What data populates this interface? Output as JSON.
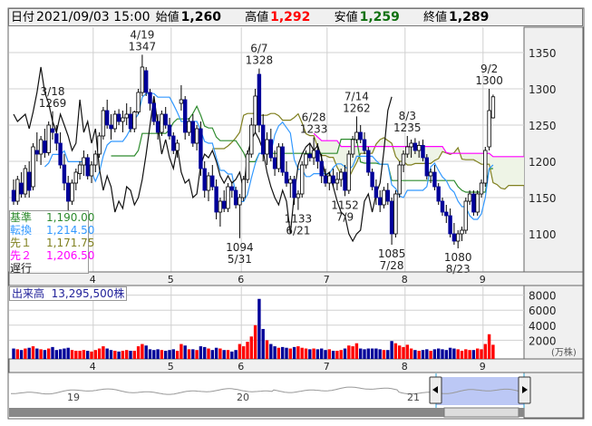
{
  "header": {
    "date_label": "日付",
    "date": "2021/09/03 15:00",
    "open_label": "始値",
    "open": "1,260",
    "high_label": "高値",
    "high": "1,292",
    "low_label": "安値",
    "low": "1,259",
    "close_label": "終値",
    "close": "1,289"
  },
  "legend": {
    "kijun": {
      "label": "基準",
      "value": "1,190.00",
      "color": "#2e8b2e"
    },
    "tenkan": {
      "label": "転換",
      "value": "1,214.50",
      "color": "#3399ff"
    },
    "senkou1": {
      "label": "先１",
      "value": "1,171.75",
      "color": "#808020"
    },
    "senkou2": {
      "label": "先２",
      "value": "1,206.50",
      "color": "#ff00ff"
    },
    "chikou": {
      "label": "遅行"
    }
  },
  "volume_label": {
    "label": "出来高",
    "value": "13,295,500株"
  },
  "colors": {
    "up_body": "#ffffff",
    "down_body": "#000099",
    "vol_up": "#ff0000",
    "vol_down": "#000099",
    "vol_flat": "#888888",
    "cloud": "#eef4e6",
    "nav_sel": "#bcc8f5"
  },
  "chart_data": {
    "type": "candlestick",
    "title": "",
    "price_axis": {
      "ticks": [
        1100,
        1150,
        1200,
        1250,
        1300,
        1350
      ],
      "range": [
        1047,
        1385
      ]
    },
    "volume_axis": {
      "ticks": [
        2000,
        4000,
        6000,
        8000
      ],
      "unit": "(万株)",
      "range": [
        0,
        9000
      ]
    },
    "month_labels": [
      {
        "label": "4",
        "start": 21
      },
      {
        "label": "5",
        "start": 41
      },
      {
        "label": "6",
        "start": 59
      },
      {
        "label": "7",
        "start": 81
      },
      {
        "label": "8",
        "start": 101
      },
      {
        "label": "9",
        "start": 121
      }
    ],
    "candles_ohlcv": [
      [
        1160,
        1175,
        1140,
        1145,
        900
      ],
      [
        1145,
        1180,
        1140,
        1175,
        800
      ],
      [
        1170,
        1185,
        1150,
        1155,
        700
      ],
      [
        1155,
        1195,
        1150,
        1190,
        900
      ],
      [
        1185,
        1200,
        1150,
        1160,
        1000
      ],
      [
        1165,
        1225,
        1160,
        1220,
        1200
      ],
      [
        1215,
        1240,
        1200,
        1210,
        900
      ],
      [
        1210,
        1235,
        1195,
        1230,
        800
      ],
      [
        1228,
        1245,
        1205,
        1212,
        700
      ],
      [
        1212,
        1255,
        1208,
        1250,
        900
      ],
      [
        1245,
        1269,
        1230,
        1240,
        1100
      ],
      [
        1238,
        1250,
        1215,
        1225,
        700
      ],
      [
        1225,
        1240,
        1190,
        1195,
        800
      ],
      [
        1195,
        1210,
        1160,
        1170,
        900
      ],
      [
        1170,
        1180,
        1130,
        1145,
        1000
      ],
      [
        1145,
        1175,
        1140,
        1170,
        700
      ],
      [
        1170,
        1190,
        1160,
        1185,
        600
      ],
      [
        1183,
        1200,
        1175,
        1195,
        600
      ],
      [
        1195,
        1215,
        1180,
        1205,
        700
      ],
      [
        1205,
        1210,
        1175,
        1180,
        600
      ],
      [
        1180,
        1200,
        1170,
        1195,
        500
      ],
      [
        1195,
        1215,
        1185,
        1210,
        700
      ],
      [
        1210,
        1240,
        1205,
        1235,
        900
      ],
      [
        1235,
        1275,
        1230,
        1270,
        1200
      ],
      [
        1270,
        1285,
        1245,
        1250,
        900
      ],
      [
        1250,
        1265,
        1230,
        1245,
        700
      ],
      [
        1245,
        1270,
        1240,
        1265,
        600
      ],
      [
        1265,
        1272,
        1250,
        1255,
        500
      ],
      [
        1255,
        1270,
        1240,
        1260,
        600
      ],
      [
        1260,
        1280,
        1250,
        1265,
        700
      ],
      [
        1265,
        1275,
        1240,
        1245,
        600
      ],
      [
        1245,
        1270,
        1240,
        1268,
        600
      ],
      [
        1268,
        1300,
        1265,
        1295,
        1200
      ],
      [
        1295,
        1347,
        1290,
        1330,
        1500
      ],
      [
        1325,
        1330,
        1290,
        1295,
        1300
      ],
      [
        1295,
        1300,
        1270,
        1280,
        800
      ],
      [
        1280,
        1285,
        1250,
        1255,
        700
      ],
      [
        1255,
        1265,
        1230,
        1240,
        800
      ],
      [
        1240,
        1270,
        1235,
        1265,
        700
      ],
      [
        1265,
        1275,
        1245,
        1250,
        600
      ],
      [
        1250,
        1260,
        1230,
        1235,
        700
      ],
      [
        1235,
        1240,
        1210,
        1215,
        800
      ],
      [
        1215,
        1230,
        1205,
        1225,
        600
      ],
      [
        1280,
        1305,
        1270,
        1285,
        1500
      ],
      [
        1285,
        1290,
        1230,
        1240,
        1300
      ],
      [
        1240,
        1260,
        1235,
        1255,
        800
      ],
      [
        1255,
        1265,
        1220,
        1225,
        800
      ],
      [
        1225,
        1250,
        1215,
        1245,
        700
      ],
      [
        1245,
        1255,
        1180,
        1190,
        1200
      ],
      [
        1190,
        1200,
        1150,
        1160,
        1100
      ],
      [
        1160,
        1185,
        1145,
        1180,
        900
      ],
      [
        1180,
        1195,
        1160,
        1165,
        700
      ],
      [
        1165,
        1175,
        1120,
        1130,
        1000
      ],
      [
        1130,
        1150,
        1110,
        1145,
        900
      ],
      [
        1145,
        1160,
        1130,
        1135,
        700
      ],
      [
        1135,
        1170,
        1130,
        1165,
        700
      ],
      [
        1165,
        1172,
        1150,
        1160,
        500
      ],
      [
        1160,
        1165,
        1135,
        1140,
        700
      ],
      [
        1140,
        1155,
        1094,
        1150,
        1500
      ],
      [
        1150,
        1180,
        1145,
        1175,
        1200
      ],
      [
        1175,
        1215,
        1170,
        1210,
        1800
      ],
      [
        1210,
        1260,
        1205,
        1250,
        2500
      ],
      [
        1250,
        1300,
        1240,
        1290,
        4000
      ],
      [
        1320,
        1328,
        1240,
        1250,
        7500
      ],
      [
        1250,
        1265,
        1200,
        1210,
        3500
      ],
      [
        1210,
        1240,
        1195,
        1230,
        2000
      ],
      [
        1230,
        1245,
        1200,
        1205,
        1500
      ],
      [
        1205,
        1215,
        1180,
        1190,
        1200
      ],
      [
        1190,
        1225,
        1185,
        1220,
        1000
      ],
      [
        1220,
        1225,
        1180,
        1185,
        1100
      ],
      [
        1185,
        1200,
        1165,
        1170,
        1000
      ],
      [
        1170,
        1180,
        1150,
        1175,
        900
      ],
      [
        1175,
        1180,
        1140,
        1150,
        1100
      ],
      [
        1150,
        1160,
        1133,
        1155,
        1200
      ],
      [
        1155,
        1200,
        1150,
        1195,
        1000
      ],
      [
        1195,
        1215,
        1190,
        1210,
        900
      ],
      [
        1210,
        1225,
        1200,
        1205,
        800
      ],
      [
        1205,
        1233,
        1195,
        1215,
        900
      ],
      [
        1215,
        1225,
        1190,
        1200,
        800
      ],
      [
        1200,
        1210,
        1170,
        1180,
        900
      ],
      [
        1180,
        1190,
        1165,
        1170,
        700
      ],
      [
        1170,
        1185,
        1160,
        1180,
        800
      ],
      [
        1180,
        1190,
        1165,
        1170,
        600
      ],
      [
        1170,
        1185,
        1160,
        1175,
        600
      ],
      [
        1175,
        1190,
        1165,
        1185,
        700
      ],
      [
        1185,
        1195,
        1152,
        1160,
        900
      ],
      [
        1160,
        1215,
        1155,
        1210,
        1300
      ],
      [
        1210,
        1235,
        1205,
        1230,
        1200
      ],
      [
        1230,
        1262,
        1225,
        1240,
        1600
      ],
      [
        1240,
        1250,
        1225,
        1230,
        900
      ],
      [
        1230,
        1240,
        1210,
        1215,
        800
      ],
      [
        1215,
        1220,
        1180,
        1185,
        900
      ],
      [
        1185,
        1190,
        1160,
        1165,
        900
      ],
      [
        1165,
        1175,
        1140,
        1150,
        900
      ],
      [
        1150,
        1160,
        1130,
        1140,
        800
      ],
      [
        1140,
        1165,
        1135,
        1160,
        700
      ],
      [
        1160,
        1170,
        1140,
        1145,
        700
      ],
      [
        1145,
        1150,
        1085,
        1100,
        1900
      ],
      [
        1100,
        1160,
        1095,
        1155,
        1600
      ],
      [
        1155,
        1200,
        1150,
        1195,
        1300
      ],
      [
        1195,
        1215,
        1185,
        1210,
        1100
      ],
      [
        1210,
        1235,
        1205,
        1220,
        1400
      ],
      [
        1220,
        1230,
        1205,
        1225,
        900
      ],
      [
        1225,
        1232,
        1210,
        1215,
        700
      ],
      [
        1215,
        1228,
        1205,
        1222,
        600
      ],
      [
        1222,
        1230,
        1200,
        1205,
        700
      ],
      [
        1205,
        1210,
        1175,
        1180,
        800
      ],
      [
        1180,
        1190,
        1170,
        1185,
        600
      ],
      [
        1185,
        1195,
        1160,
        1165,
        800
      ],
      [
        1165,
        1170,
        1140,
        1145,
        900
      ],
      [
        1145,
        1150,
        1125,
        1130,
        800
      ],
      [
        1130,
        1140,
        1115,
        1125,
        700
      ],
      [
        1125,
        1135,
        1095,
        1100,
        1000
      ],
      [
        1100,
        1115,
        1085,
        1090,
        900
      ],
      [
        1090,
        1105,
        1080,
        1100,
        800
      ],
      [
        1100,
        1110,
        1090,
        1105,
        600
      ],
      [
        1105,
        1150,
        1100,
        1145,
        800
      ],
      [
        1145,
        1160,
        1140,
        1155,
        700
      ],
      [
        1155,
        1160,
        1125,
        1130,
        700
      ],
      [
        1130,
        1160,
        1125,
        1155,
        900
      ],
      [
        1155,
        1175,
        1150,
        1170,
        800
      ],
      [
        1170,
        1220,
        1165,
        1215,
        1500
      ],
      [
        1220,
        1300,
        1215,
        1270,
        2800
      ],
      [
        1260,
        1292,
        1259,
        1289,
        1400
      ]
    ],
    "annotations": [
      {
        "date": "3/18",
        "price": "1269",
        "index": 10,
        "pos": "above"
      },
      {
        "date": "4/19",
        "price": "1347",
        "index": 33,
        "pos": "above"
      },
      {
        "date": "5/31",
        "price": "1094",
        "index": 58,
        "pos": "below"
      },
      {
        "date": "6/7",
        "price": "1328",
        "index": 63,
        "pos": "above"
      },
      {
        "date": "6/21",
        "price": "1133",
        "index": 73,
        "pos": "below"
      },
      {
        "date": "6/28",
        "price": "1233",
        "index": 77,
        "pos": "above"
      },
      {
        "date": "7/9",
        "price": "1152",
        "index": 85,
        "pos": "below"
      },
      {
        "date": "7/14",
        "price": "1262",
        "index": 88,
        "pos": "above"
      },
      {
        "date": "7/28",
        "price": "1085",
        "index": 97,
        "pos": "below"
      },
      {
        "date": "8/3",
        "price": "1235",
        "index": 101,
        "pos": "above"
      },
      {
        "date": "8/23",
        "price": "1080",
        "index": 114,
        "pos": "below"
      },
      {
        "date": "9/2",
        "price": "1300",
        "index": 122,
        "pos": "above"
      }
    ],
    "navigator": {
      "year_labels": [
        "19",
        "20",
        "21"
      ]
    }
  }
}
